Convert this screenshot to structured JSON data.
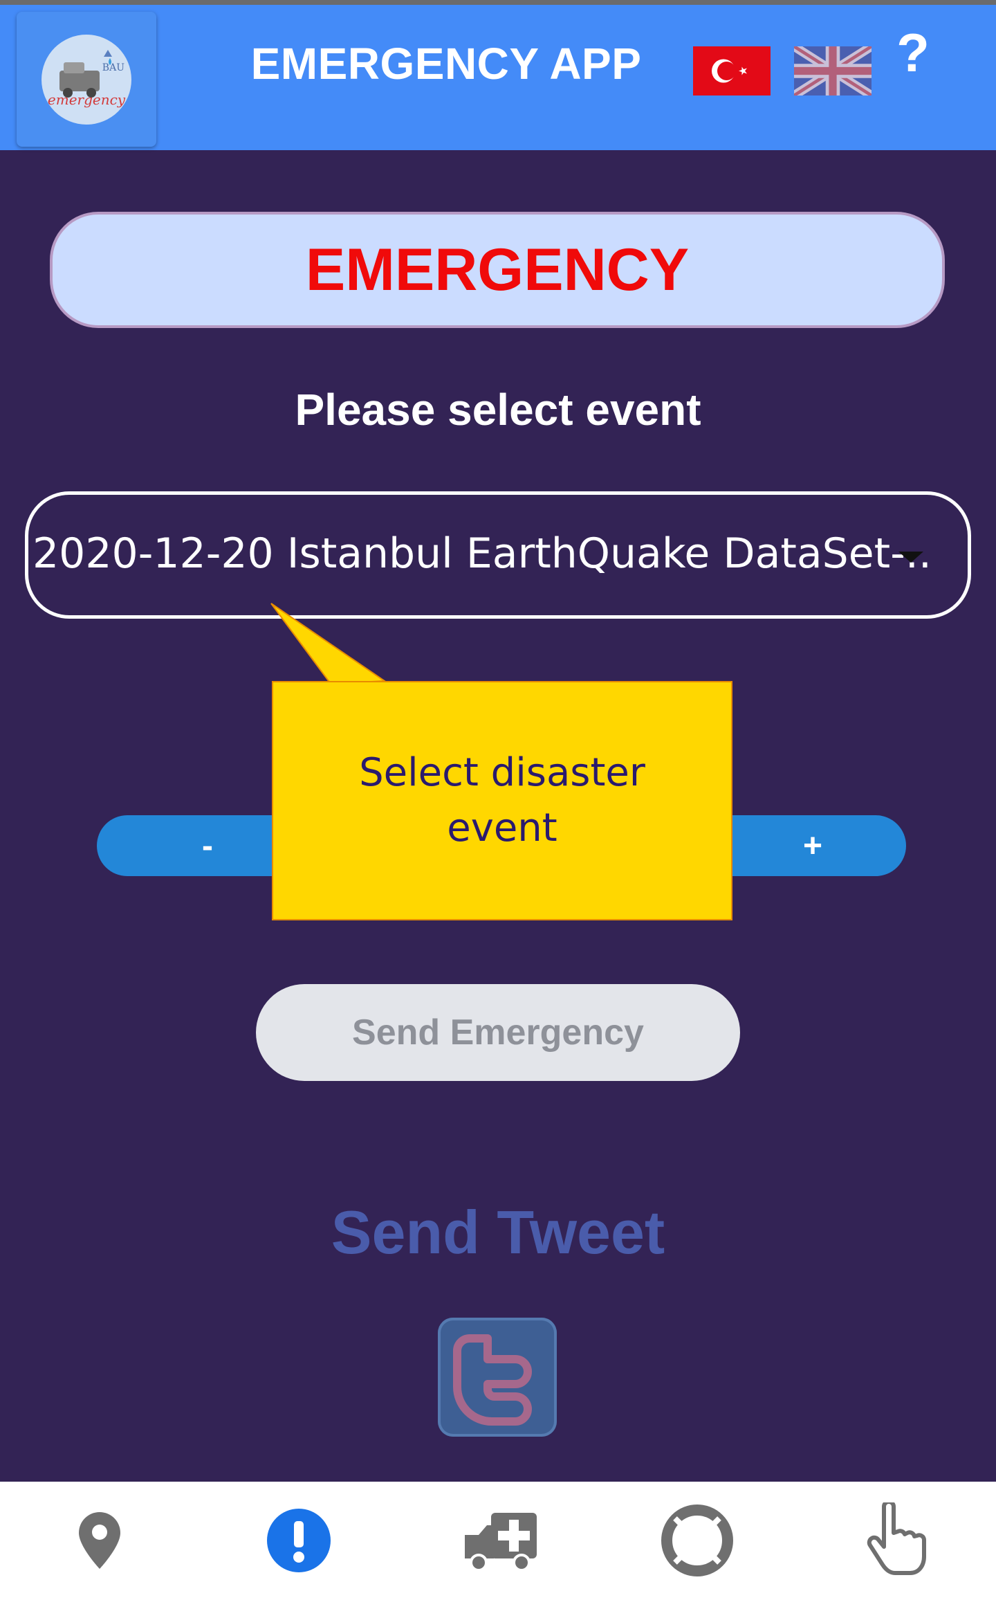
{
  "header": {
    "app_title": "EMERGENCY APP",
    "logo_text": "emergency",
    "logo_sub": "BAU",
    "help_label": "?"
  },
  "main": {
    "emergency_label": "EMERGENCY",
    "select_title": "Please select event",
    "selected_event": "2020-12-20 Istanbul EarthQuake DataSet-..",
    "stepper_minus": "-",
    "stepper_plus": "+",
    "tooltip_text": "Select disaster event",
    "send_emergency_label": "Send Emergency",
    "send_tweet_label": "Send Tweet"
  },
  "tabbar": {
    "tabs": [
      {
        "icon": "location-pin-icon",
        "active": false
      },
      {
        "icon": "alert-icon",
        "active": true
      },
      {
        "icon": "ambulance-icon",
        "active": false
      },
      {
        "icon": "lifebuoy-icon",
        "active": false
      },
      {
        "icon": "hand-pointer-icon",
        "active": false
      }
    ]
  },
  "colors": {
    "header_bg": "#448bf8",
    "page_bg": "#332355",
    "emergency_text": "#f00a0a",
    "tooltip_bg": "#ffd700",
    "stepper_bg": "#2387d8",
    "active_tab": "#1a73e8",
    "inactive_tab": "#6f6f6f"
  }
}
